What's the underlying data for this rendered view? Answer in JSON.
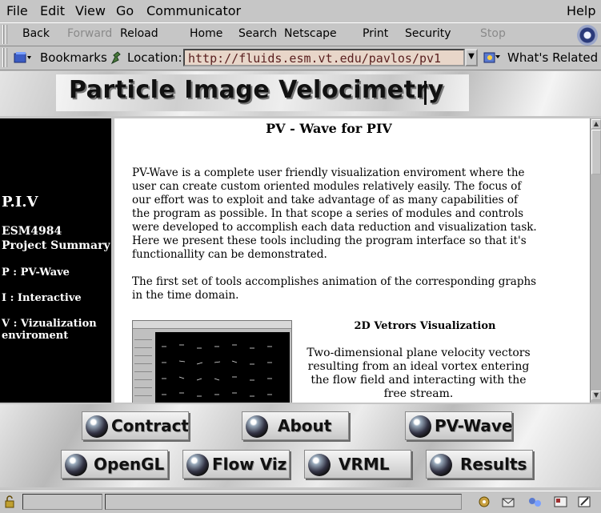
{
  "menu": {
    "file": "File",
    "edit": "Edit",
    "view": "View",
    "go": "Go",
    "communicator": "Communicator",
    "help": "Help"
  },
  "toolbar": {
    "back": "Back",
    "forward": "Forward",
    "reload": "Reload",
    "home": "Home",
    "search": "Search",
    "netscape": "Netscape",
    "print": "Print",
    "security": "Security",
    "stop": "Stop"
  },
  "location": {
    "bookmarks": "Bookmarks",
    "label": "Location:",
    "url": "http://fluids.esm.vt.edu/pavlos/pv1",
    "whats_related": "What's Related"
  },
  "banner": {
    "title": "Particle Image Velocimetry"
  },
  "leftnav": {
    "piv": "P.I.V",
    "project": "ESM4984 Project Summary",
    "p": "P : PV-Wave",
    "i": "I : Interactive",
    "v": "V : Vizualization enviroment"
  },
  "main": {
    "title": "PV - Wave for PIV",
    "para1": "PV-Wave is a complete user friendly visualization enviroment where the user can create custom oriented modules relatively easily. The focus of our effort was to exploit and take advantage of as many capabilities of the program as possible. In that scope a series of modules and controls were developed to accomplish each data reduction and visualization task. Here we present these tools including the program interface so that it's functionallity can be demonstrated.",
    "para2": "The first set of tools accomplishes animation of the corresponding graphs in the time domain.",
    "caption_title": "2D Vetrors Visualization",
    "caption_text": "Two-dimensional plane velocity vectors resulting from an ideal vortex entering the flow field and interacting with the free stream."
  },
  "nav_buttons": {
    "contract": "Contract",
    "about": "About",
    "pvwave": "PV-Wave",
    "opengl": "OpenGL",
    "flowviz": "Flow Viz",
    "vrml": "VRML",
    "results": "Results"
  },
  "colors": {
    "chrome": "#c6c6c6",
    "url_field": "#e8d6c9",
    "left_nav_bg": "#000000",
    "content_bg": "#ffffff"
  }
}
